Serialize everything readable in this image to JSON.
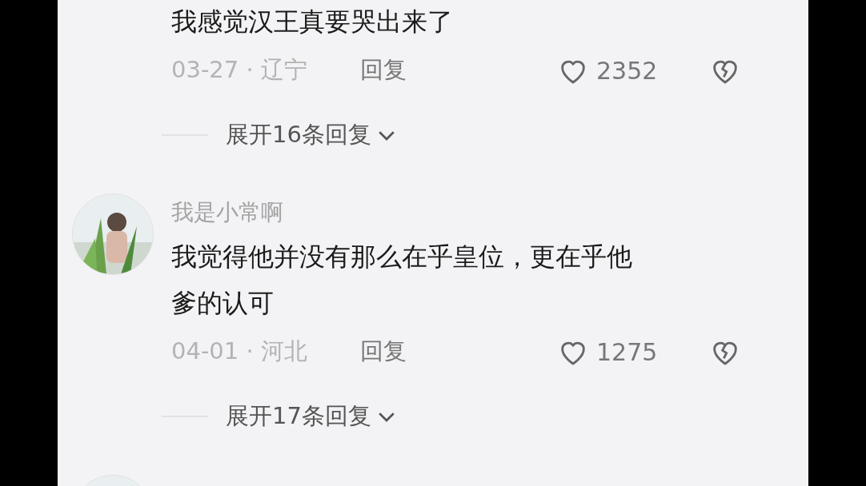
{
  "comments": [
    {
      "text": "我感觉汉王真要哭出来了",
      "date_location": "03-27 · 辽宁",
      "reply": "回复",
      "likes": "2352",
      "liked": false,
      "expand": "展开16条回复"
    },
    {
      "avatar": {
        "kind": "picture"
      },
      "name": "我是小常啊",
      "text": "我觉得他并没有那么在乎皇位，更在乎他爹的认可",
      "date_location": "04-01 · 河北",
      "reply": "回复",
      "likes": "1275",
      "liked": false,
      "expand": "展开17条回复"
    },
    {
      "avatar": {
        "kind": "picture"
      }
    }
  ]
}
